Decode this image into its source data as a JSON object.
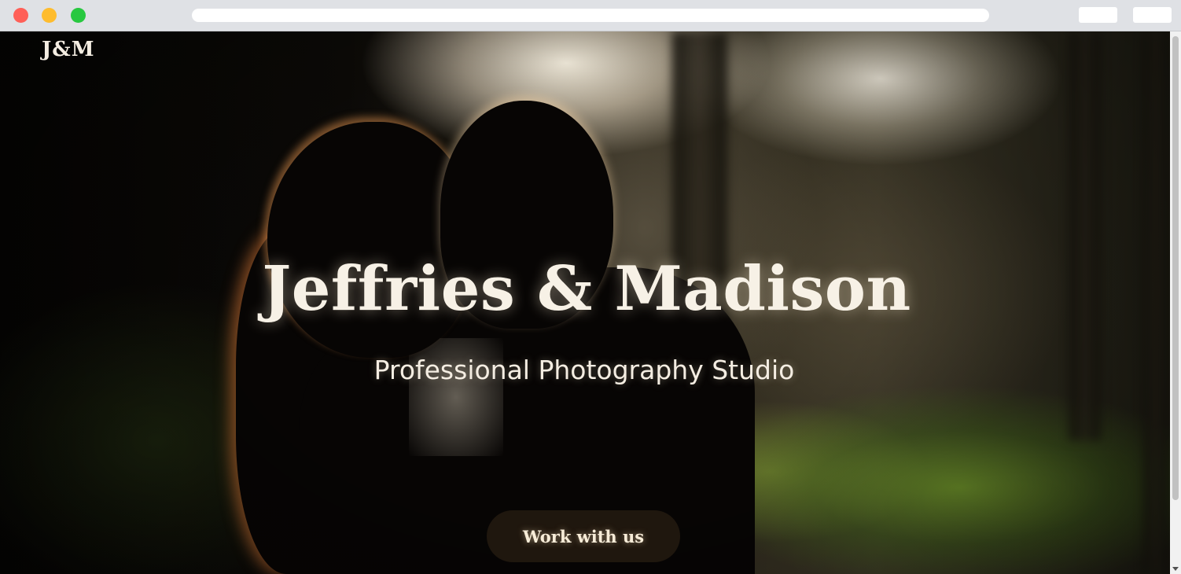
{
  "site": {
    "logo": "J&M"
  },
  "hero": {
    "title": "Jeffries & Madison",
    "subtitle": "Professional Photography Studio",
    "cta_label": "Work with us"
  },
  "colors": {
    "text_light": "#f7f1e6",
    "button_bg": "#281e12"
  }
}
